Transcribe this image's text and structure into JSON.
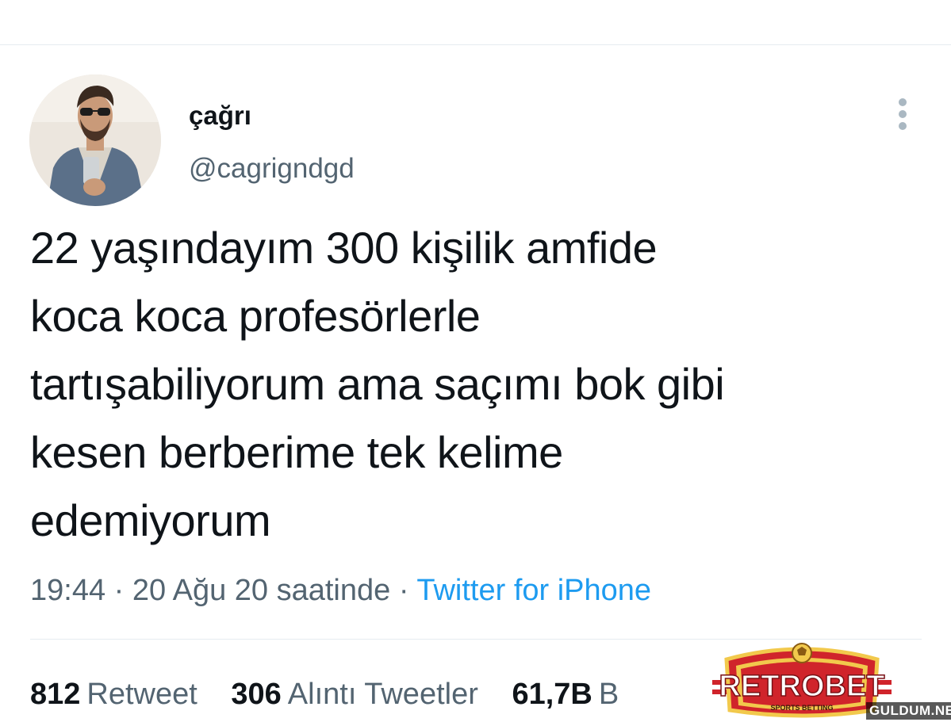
{
  "tweet": {
    "author": {
      "display_name": "çağrı",
      "handle": "@cagrigndgd"
    },
    "text_lines": [
      "22 yaşındayım 300 kişilik amfide",
      "koca koca profesörlerle",
      "tartışabiliyorum ama saçımı bok gibi",
      "kesen berberime tek kelime",
      "edemiyorum"
    ],
    "meta": {
      "time": "19:44",
      "separator": "·",
      "date": "20 Ağu 20 saatinde",
      "source": "Twitter for iPhone"
    },
    "stats": [
      {
        "count": "812",
        "label": "Retweet"
      },
      {
        "count": "306",
        "label": "Alıntı Tweetler"
      },
      {
        "count": "61,7B",
        "label": "B"
      }
    ]
  },
  "overlay": {
    "logo_text": "RETROBET",
    "logo_subtext": "SPORTS BETTING",
    "watermark": "GULDUM.NET"
  },
  "colors": {
    "text_primary": "#0f1419",
    "text_secondary": "#536471",
    "link": "#1d9bf0",
    "divider": "#e6ecf0",
    "logo_red": "#d0242b",
    "logo_gold": "#f2c94c"
  },
  "icons": {
    "more": "more-vertical-icon"
  }
}
